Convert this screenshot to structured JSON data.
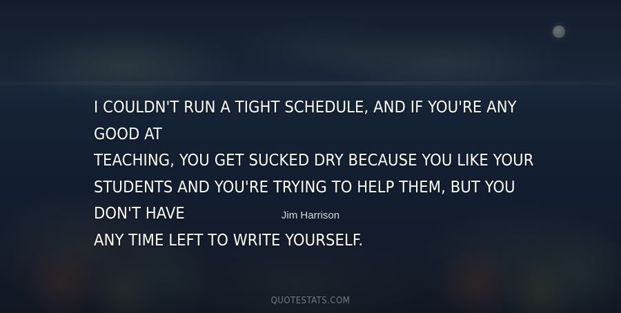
{
  "quote": {
    "text": "I couldn't run a tight schedule, and if you're any good at\nteaching, you get sucked dry because you like your\nstudents and you're trying to help them, but you don't have\nany time left to write yourself."
  },
  "author": {
    "name": "Jim Harrison"
  },
  "watermark": {
    "text": "QUOTESTATS.COM"
  },
  "colors": {
    "text": "#ffffff",
    "background": "#1b2a40"
  }
}
